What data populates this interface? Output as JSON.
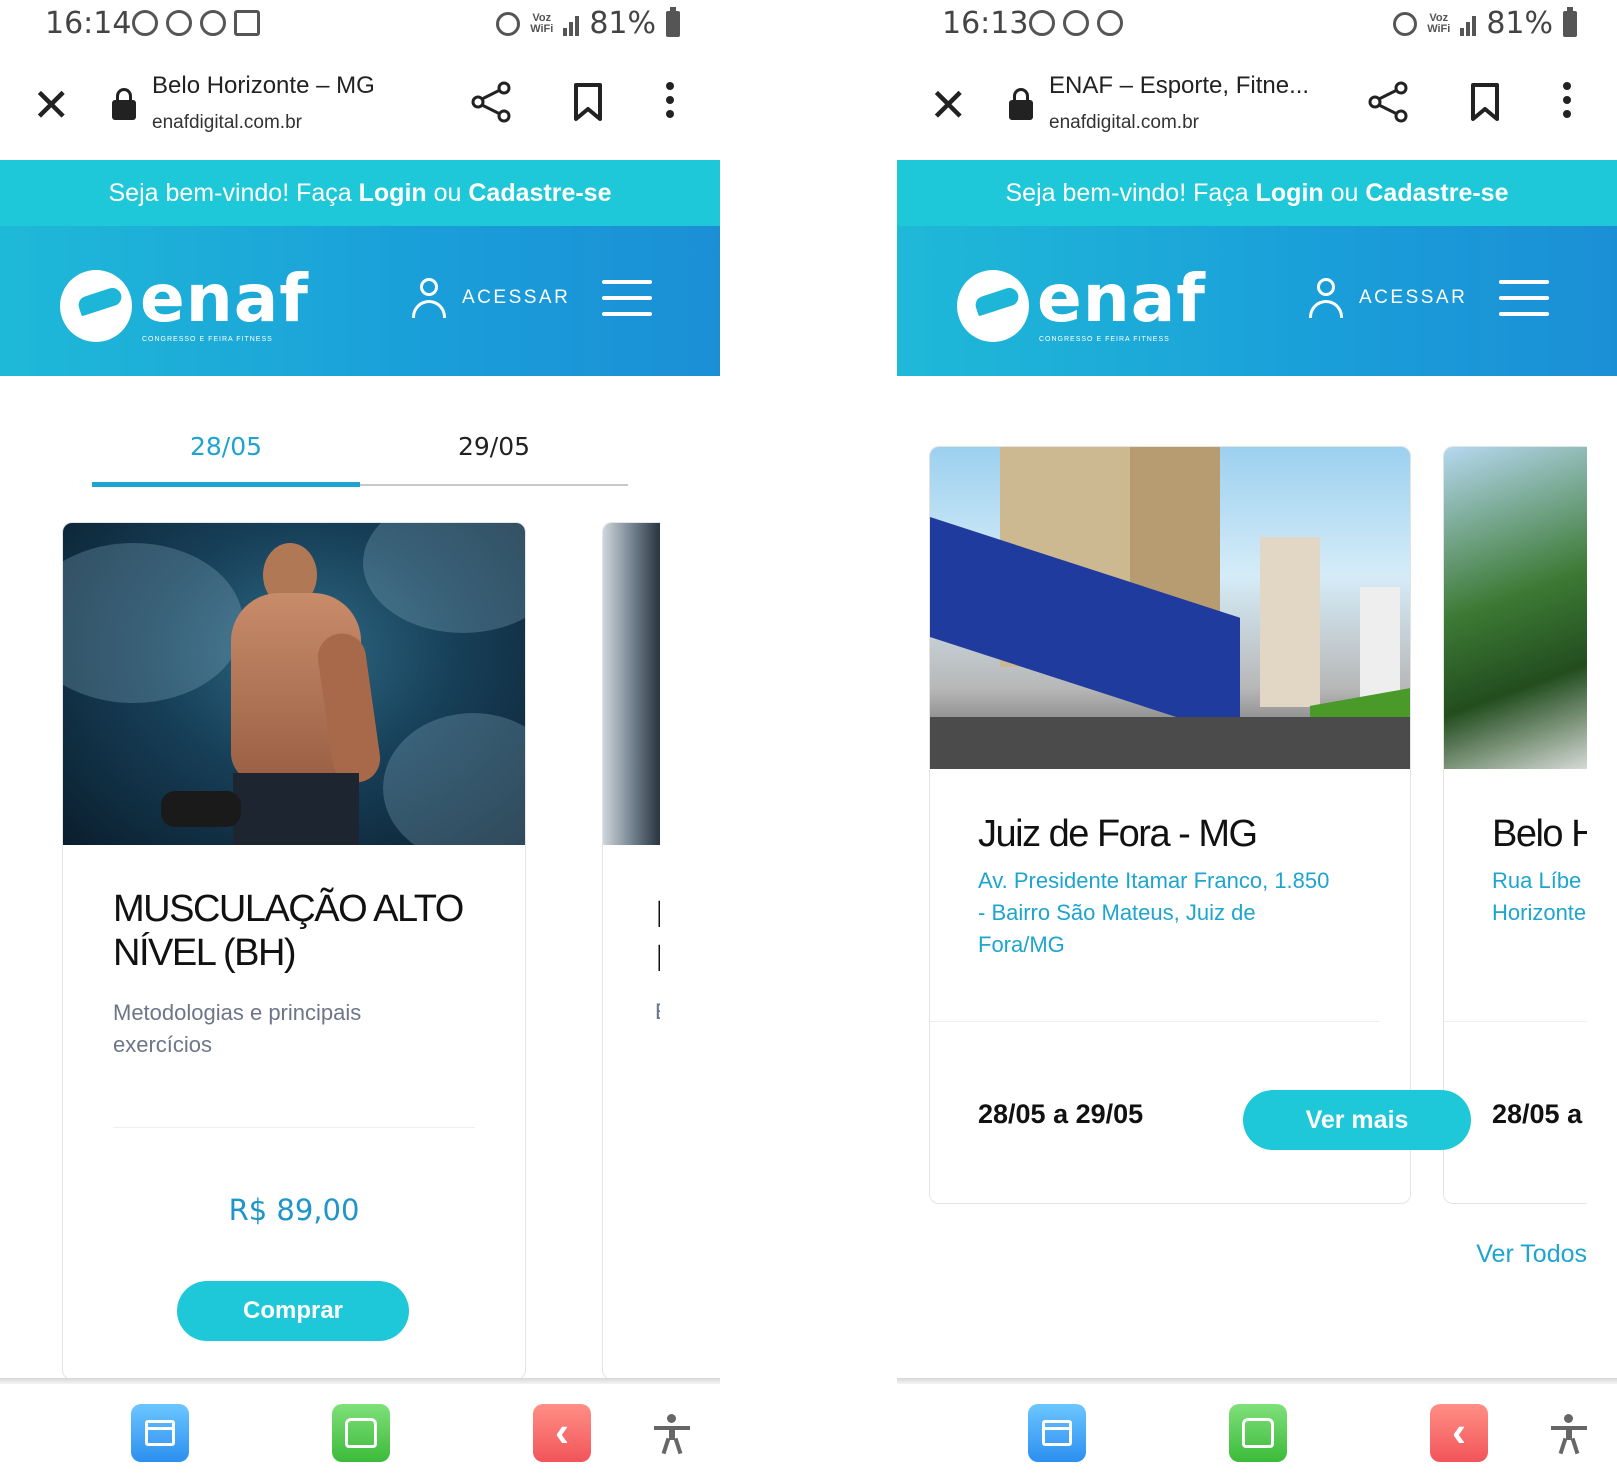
{
  "left": {
    "status": {
      "time": "16:14",
      "voz": "Voz",
      "wifi": "WiFi",
      "battery": "81%"
    },
    "browser": {
      "title": "Belo Horizonte – MG",
      "domain": "enafdigital.com.br"
    },
    "welcome": {
      "prefix": "Seja bem-vindo! Faça ",
      "login": "Login",
      "or": " ou ",
      "signup": "Cadastre-se"
    },
    "header": {
      "logo_text": "enaf",
      "logo_tagline": "CONGRESSO E FEIRA FITNESS",
      "acessar": "ACESSAR"
    },
    "date_tabs": [
      "28/05",
      "29/05"
    ],
    "course": {
      "title": "MUSCULAÇÃO ALTO NÍVEL (BH)",
      "description": "Metodologias e principais exercícios",
      "price": "R$ 89,00",
      "buy": "Comprar"
    },
    "peek": {
      "title_line1": "I",
      "title_line2": "I",
      "desc": "E"
    }
  },
  "right": {
    "status": {
      "time": "16:13",
      "voz": "Voz",
      "wifi": "WiFi",
      "battery": "81%"
    },
    "browser": {
      "title": "ENAF – Esporte, Fitne...",
      "domain": "enafdigital.com.br"
    },
    "welcome": {
      "prefix": "Seja bem-vindo! Faça ",
      "login": "Login",
      "or": " ou ",
      "signup": "Cadastre-se"
    },
    "header": {
      "logo_text": "enaf",
      "logo_tagline": "CONGRESSO E FEIRA FITNESS",
      "acessar": "ACESSAR"
    },
    "event": {
      "city": "Juiz de Fora - MG",
      "address": "Av. Presidente Itamar Franco, 1.850 - Bairro São Mateus, Juiz de Fora/MG",
      "dates": "28/05 a 29/05",
      "ver_mais": "Ver mais"
    },
    "peek": {
      "city": "Belo H",
      "address_line1": "Rua Líbe",
      "address_line2": "Horizonte",
      "dates": "28/05 a"
    },
    "ver_todos": "Ver Todos"
  },
  "icons": [
    "close-icon",
    "lock-icon",
    "share-icon",
    "bookmark-icon",
    "more-icon",
    "user-icon",
    "menu-icon",
    "tabs-icon",
    "home-icon",
    "back-icon",
    "accessibility-icon"
  ],
  "colors": {
    "welcome_bar": "#1ec8d8",
    "header_gradient_start": "#1fb9d8",
    "header_gradient_end": "#1b8fd6",
    "accent": "#1ea4d0",
    "button": "#1ec8d8"
  }
}
